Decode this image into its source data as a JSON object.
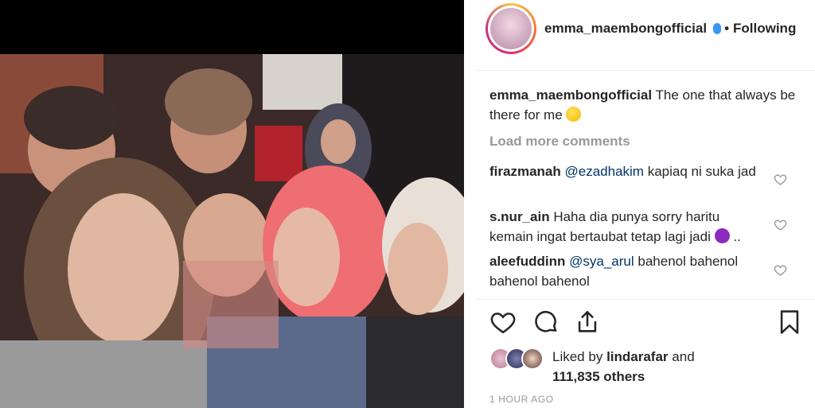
{
  "post": {
    "username": "emma_maembongofficial",
    "follow_status": "Following",
    "separator": "•",
    "caption": {
      "username": "emma_maembongofficial",
      "text": "The one that always be there for me",
      "emoji": "slightly-smiling-face"
    },
    "load_more_label": "Load more comments",
    "comments": [
      {
        "username": "firazmanah",
        "mention": "@ezadhakim",
        "text": "kapiaq ni suka jad"
      },
      {
        "username": "s.nur_ain",
        "mention": "",
        "text": "Haha dia punya sorry haritu kemain ingat bertaubat tetap lagi jadi",
        "emoji": "smiling-devil",
        "suffix": ".."
      },
      {
        "username": "aleefuddinn",
        "mention": "@sya_arul",
        "text": "bahenol bahenol bahenol bahenol"
      }
    ],
    "likes": {
      "prefix": "Liked by",
      "user": "lindarafar",
      "connector": "and",
      "count": "111,835 others"
    },
    "timestamp": "1 HOUR AGO",
    "icons": [
      "heart-icon",
      "comment-icon",
      "share-icon",
      "bookmark-icon"
    ],
    "colors": {
      "verified": "#3897f0",
      "mention": "#003569",
      "muted": "#999999",
      "text": "#262626"
    }
  }
}
